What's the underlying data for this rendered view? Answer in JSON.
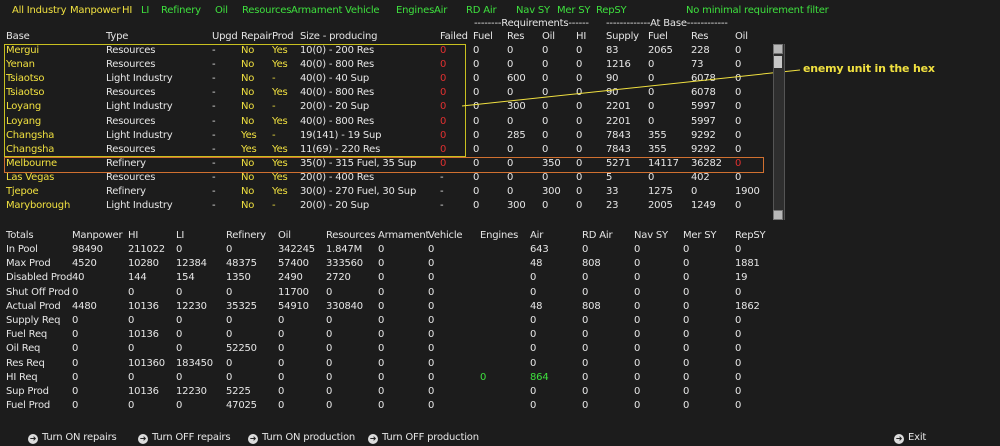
{
  "filters": [
    {
      "label": "All Industry",
      "active": false
    },
    {
      "label": "Manpower",
      "active": false
    },
    {
      "label": "HI",
      "active": false
    },
    {
      "label": "LI",
      "active": true
    },
    {
      "label": "Refinery",
      "active": true
    },
    {
      "label": "Oil",
      "active": true
    },
    {
      "label": "Resources",
      "active": true
    },
    {
      "label": "Armament",
      "active": true
    },
    {
      "label": "Vehicle",
      "active": true
    },
    {
      "label": "Engines",
      "active": true
    },
    {
      "label": "Air",
      "active": true
    },
    {
      "label": "RD Air",
      "active": true
    },
    {
      "label": "Nav SY",
      "active": true
    },
    {
      "label": "Mer SY",
      "active": true
    },
    {
      "label": "RepSY",
      "active": true
    },
    {
      "label": "No minimal requirement filter",
      "active": true
    }
  ],
  "group_headers": {
    "requirements": "--------Requirements------",
    "at_base": "-------------At Base------------"
  },
  "columns": [
    "Base",
    "Type",
    "Upgd",
    "Repair",
    "Prod",
    "Size - producing",
    "Failed",
    "Fuel",
    "Res",
    "Oil",
    "HI",
    "Supply",
    "Fuel",
    "Res",
    "Oil"
  ],
  "rows": [
    {
      "base": "Mergui",
      "type": "Resources",
      "upgd": "-",
      "repair": "No",
      "prod": "Yes",
      "size": "10(0) - 200 Res",
      "failed": "0",
      "fuel": "0",
      "res": "0",
      "oil": "0",
      "hi": "0",
      "supply": "83",
      "bfuel": "2065",
      "bres": "228",
      "boil": "0",
      "base_color": "yellow"
    },
    {
      "base": "Yenan",
      "type": "Resources",
      "upgd": "-",
      "repair": "No",
      "prod": "Yes",
      "size": "40(0) - 800 Res",
      "failed": "0",
      "fuel": "0",
      "res": "0",
      "oil": "0",
      "hi": "0",
      "supply": "1216",
      "bfuel": "0",
      "bres": "73",
      "boil": "0",
      "base_color": "yellow"
    },
    {
      "base": "Tsiaotso",
      "type": "Light Industry",
      "upgd": "-",
      "repair": "No",
      "prod": "-",
      "size": "40(0) - 40 Sup",
      "failed": "0",
      "fuel": "0",
      "res": "600",
      "oil": "0",
      "hi": "0",
      "supply": "90",
      "bfuel": "0",
      "bres": "6078",
      "boil": "0",
      "base_color": "yellow"
    },
    {
      "base": "Tsiaotso",
      "type": "Resources",
      "upgd": "-",
      "repair": "No",
      "prod": "Yes",
      "size": "40(0) - 800 Res",
      "failed": "0",
      "fuel": "0",
      "res": "0",
      "oil": "0",
      "hi": "0",
      "supply": "90",
      "bfuel": "0",
      "bres": "6078",
      "boil": "0",
      "base_color": "yellow"
    },
    {
      "base": "Loyang",
      "type": "Light Industry",
      "upgd": "-",
      "repair": "No",
      "prod": "-",
      "size": "20(0) - 20 Sup",
      "failed": "0",
      "fuel": "0",
      "res": "300",
      "oil": "0",
      "hi": "0",
      "supply": "2201",
      "bfuel": "0",
      "bres": "5997",
      "boil": "0",
      "base_color": "yellow"
    },
    {
      "base": "Loyang",
      "type": "Resources",
      "upgd": "-",
      "repair": "No",
      "prod": "Yes",
      "size": "40(0) - 800 Res",
      "failed": "0",
      "fuel": "0",
      "res": "0",
      "oil": "0",
      "hi": "0",
      "supply": "2201",
      "bfuel": "0",
      "bres": "5997",
      "boil": "0",
      "base_color": "yellow"
    },
    {
      "base": "Changsha",
      "type": "Light Industry",
      "upgd": "-",
      "repair": "Yes",
      "prod": "-",
      "size": "19(141) - 19 Sup",
      "failed": "0",
      "fuel": "0",
      "res": "285",
      "oil": "0",
      "hi": "0",
      "supply": "7843",
      "bfuel": "355",
      "bres": "9292",
      "boil": "0",
      "base_color": "yellow"
    },
    {
      "base": "Changsha",
      "type": "Resources",
      "upgd": "-",
      "repair": "Yes",
      "prod": "Yes",
      "size": "11(69) - 220 Res",
      "failed": "0",
      "fuel": "0",
      "res": "0",
      "oil": "0",
      "hi": "0",
      "supply": "7843",
      "bfuel": "355",
      "bres": "9292",
      "boil": "0",
      "base_color": "yellow"
    },
    {
      "base": "Melbourne",
      "type": "Refinery",
      "upgd": "-",
      "repair": "No",
      "prod": "Yes",
      "size": "35(0) - 315 Fuel, 35 Sup",
      "failed": "0",
      "fuel": "0",
      "res": "0",
      "oil": "350",
      "hi": "0",
      "supply": "5271",
      "bfuel": "14117",
      "bres": "36282",
      "boil": "0",
      "base_color": "yellow"
    },
    {
      "base": "Las Vegas",
      "type": "Resources",
      "upgd": "-",
      "repair": "No",
      "prod": "Yes",
      "size": "20(0) - 400 Res",
      "failed": "-",
      "fuel": "0",
      "res": "0",
      "oil": "0",
      "hi": "0",
      "supply": "5",
      "bfuel": "0",
      "bres": "402",
      "boil": "0",
      "base_color": "yellow"
    },
    {
      "base": "Tjepoe",
      "type": "Refinery",
      "upgd": "-",
      "repair": "No",
      "prod": "Yes",
      "size": "30(0) - 270 Fuel, 30 Sup",
      "failed": "-",
      "fuel": "0",
      "res": "0",
      "oil": "300",
      "hi": "0",
      "supply": "33",
      "bfuel": "1275",
      "bres": "0",
      "boil": "1900",
      "base_color": "yellow"
    },
    {
      "base": "Maryborough",
      "type": "Light Industry",
      "upgd": "-",
      "repair": "No",
      "prod": "-",
      "size": "20(0) - 20 Sup",
      "failed": "-",
      "fuel": "0",
      "res": "300",
      "oil": "0",
      "hi": "0",
      "supply": "23",
      "bfuel": "2005",
      "bres": "1249",
      "boil": "0",
      "base_color": "yellow"
    }
  ],
  "annotation": "enemy unit in the hex",
  "totals_headers": [
    "Totals",
    "Manpower",
    "HI",
    "LI",
    "Refinery",
    "Oil",
    "Resources",
    "Armament",
    "Vehicle",
    "Engines",
    "Air",
    "RD Air",
    "Nav SY",
    "Mer SY",
    "RepSY"
  ],
  "totals": [
    {
      "label": "In Pool",
      "values": [
        "98490",
        "211022",
        "0",
        "0",
        "342245",
        "1.847M",
        "0",
        "0",
        "",
        "643",
        "0",
        "0",
        "0",
        "0"
      ]
    },
    {
      "label": "Max Prod",
      "values": [
        "4520",
        "10280",
        "12384",
        "48375",
        "57400",
        "333560",
        "0",
        "0",
        "",
        "48",
        "808",
        "0",
        "0",
        "1881"
      ]
    },
    {
      "label": "Disabled Prod",
      "values": [
        "40",
        "144",
        "154",
        "1350",
        "2490",
        "2720",
        "0",
        "0",
        "",
        "0",
        "0",
        "0",
        "0",
        "19"
      ]
    },
    {
      "label": "Shut Off Prod",
      "values": [
        "0",
        "0",
        "0",
        "0",
        "11700",
        "0",
        "0",
        "0",
        "",
        "0",
        "0",
        "0",
        "0",
        "0"
      ]
    },
    {
      "label": "Actual Prod",
      "values": [
        "4480",
        "10136",
        "12230",
        "35325",
        "54910",
        "330840",
        "0",
        "0",
        "",
        "48",
        "808",
        "0",
        "0",
        "1862"
      ]
    },
    {
      "label": "Supply Req",
      "values": [
        "0",
        "0",
        "0",
        "0",
        "0",
        "0",
        "0",
        "0",
        "",
        "0",
        "0",
        "0",
        "0",
        "0"
      ]
    },
    {
      "label": "Fuel Req",
      "values": [
        "0",
        "10136",
        "0",
        "0",
        "0",
        "0",
        "0",
        "0",
        "",
        "0",
        "0",
        "0",
        "0",
        "0"
      ]
    },
    {
      "label": "Oil Req",
      "values": [
        "0",
        "0",
        "0",
        "52250",
        "0",
        "0",
        "0",
        "0",
        "",
        "0",
        "0",
        "0",
        "0",
        "0"
      ]
    },
    {
      "label": "Res Req",
      "values": [
        "0",
        "101360",
        "183450",
        "0",
        "0",
        "0",
        "0",
        "0",
        "",
        "0",
        "0",
        "0",
        "0",
        "0"
      ]
    },
    {
      "label": "HI Req",
      "values": [
        "0",
        "0",
        "0",
        "0",
        "0",
        "0",
        "0",
        "0",
        "0",
        "864",
        "0",
        "0",
        "0",
        "0"
      ]
    },
    {
      "label": "Sup Prod",
      "values": [
        "0",
        "10136",
        "12230",
        "5225",
        "0",
        "0",
        "0",
        "0",
        "",
        "0",
        "0",
        "0",
        "0",
        "0"
      ]
    },
    {
      "label": "Fuel Prod",
      "values": [
        "0",
        "0",
        "0",
        "47025",
        "0",
        "0",
        "0",
        "0",
        "",
        "0",
        "0",
        "0",
        "0",
        "0"
      ]
    }
  ],
  "bottom_buttons": [
    "Turn ON repairs",
    "Turn OFF repairs",
    "Turn ON production",
    "Turn OFF production"
  ],
  "exit_label": "Exit",
  "colors": {
    "yellow": "#f0e040",
    "green": "#3ee03e",
    "red": "#e03030",
    "orange_box": "#d07030",
    "bg": "#1c1c1c"
  }
}
